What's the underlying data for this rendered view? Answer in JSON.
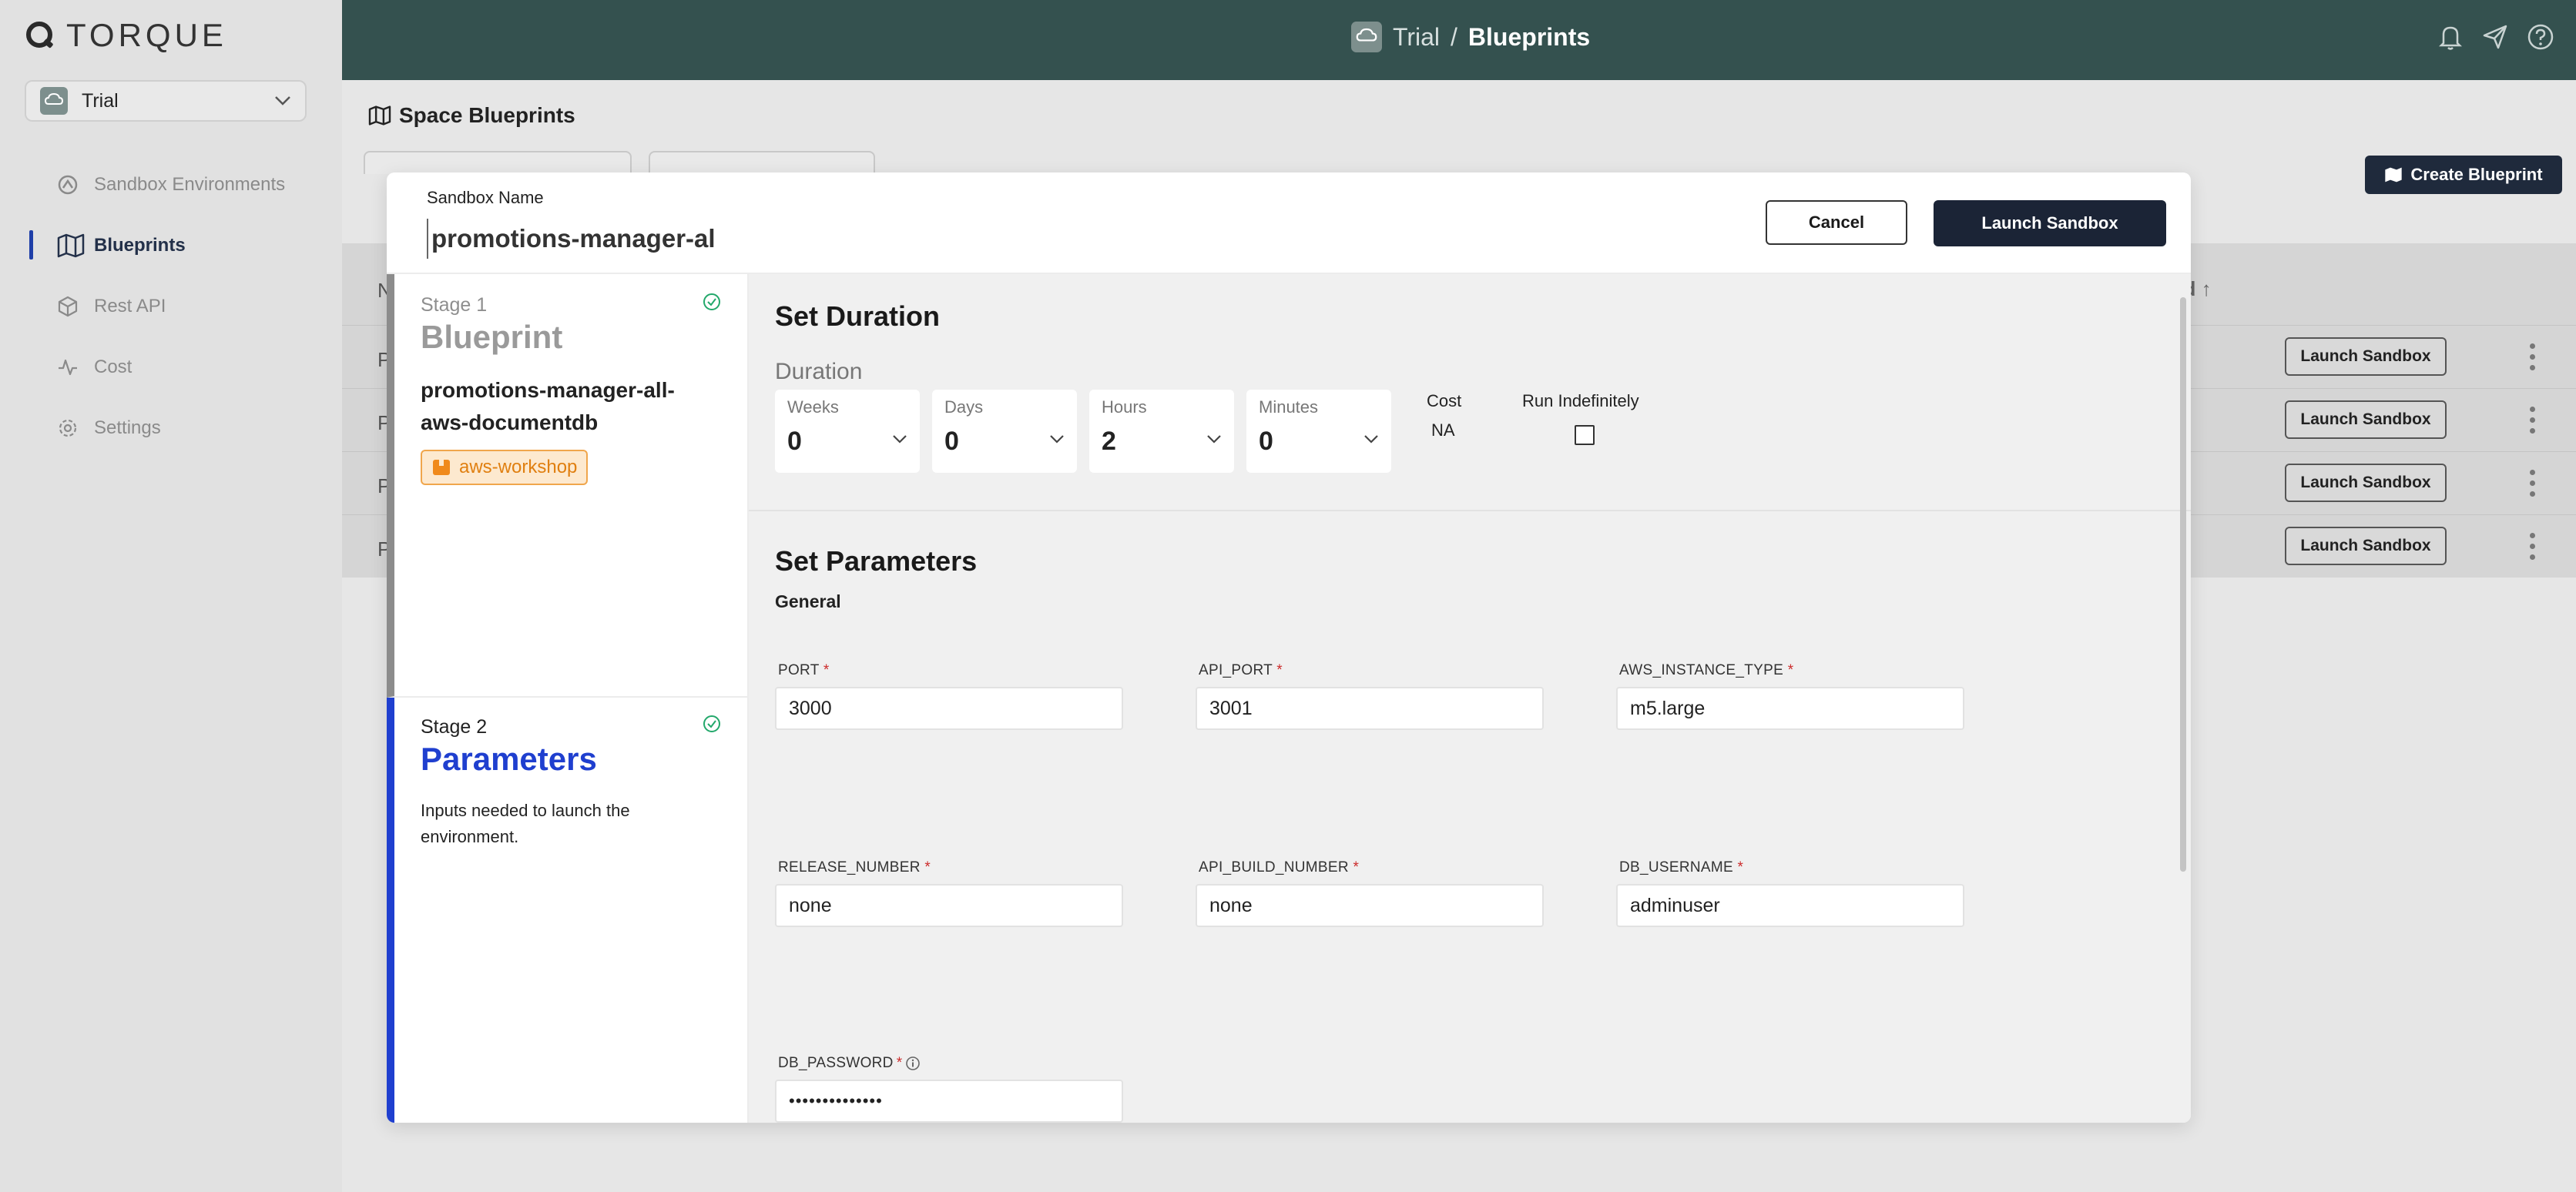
{
  "app": {
    "logo_text": "TORQUE"
  },
  "space_selector": {
    "label": "Trial"
  },
  "sidebar": {
    "items": [
      {
        "label": "Sandbox Environments",
        "icon": "sandbox-icon"
      },
      {
        "label": "Blueprints",
        "icon": "map-icon",
        "active": true
      },
      {
        "label": "Rest API",
        "icon": "cube-icon"
      },
      {
        "label": "Cost",
        "icon": "activity-icon"
      },
      {
        "label": "Settings",
        "icon": "gear-icon"
      }
    ]
  },
  "header": {
    "space": "Trial",
    "separator": "/",
    "page": "Blueprints"
  },
  "background_page": {
    "title": "Space Blueprints",
    "create_label": "Create Blueprint",
    "column_fragment": "ed",
    "row_letter": "P",
    "header_letter": "N",
    "row_launch_label": "Launch Sandbox"
  },
  "modal": {
    "sandbox_name_label": "Sandbox Name",
    "sandbox_name_value": "promotions-manager-al",
    "cancel_label": "Cancel",
    "launch_label": "Launch Sandbox",
    "stage1": {
      "number": "Stage 1",
      "title": "Blueprint",
      "blueprint_name": "promotions-manager-all-aws-documentdb",
      "tag": "aws-workshop"
    },
    "stage2": {
      "number": "Stage 2",
      "title": "Parameters",
      "description": "Inputs needed to launch the environment."
    },
    "duration": {
      "section_title": "Set Duration",
      "label": "Duration",
      "weeks_label": "Weeks",
      "weeks_value": "0",
      "days_label": "Days",
      "days_value": "0",
      "hours_label": "Hours",
      "hours_value": "2",
      "minutes_label": "Minutes",
      "minutes_value": "0",
      "cost_label": "Cost",
      "cost_value": "NA",
      "run_indefinitely_label": "Run Indefinitely",
      "run_indefinitely_checked": false
    },
    "parameters": {
      "section_title": "Set Parameters",
      "group": "General",
      "fields": [
        {
          "name": "PORT",
          "value": "3000"
        },
        {
          "name": "API_PORT",
          "value": "3001"
        },
        {
          "name": "AWS_INSTANCE_TYPE",
          "value": "m5.large"
        },
        {
          "name": "RELEASE_NUMBER",
          "value": "none"
        },
        {
          "name": "API_BUILD_NUMBER",
          "value": "none"
        },
        {
          "name": "DB_USERNAME",
          "value": "adminuser"
        },
        {
          "name": "DB_PASSWORD",
          "value": "••••••••••••••"
        }
      ],
      "required_marker": "*"
    }
  },
  "colors": {
    "header": "#34514f",
    "accent": "#1f3fcf",
    "dark_button": "#1b2436",
    "tag": "#e07f10"
  }
}
